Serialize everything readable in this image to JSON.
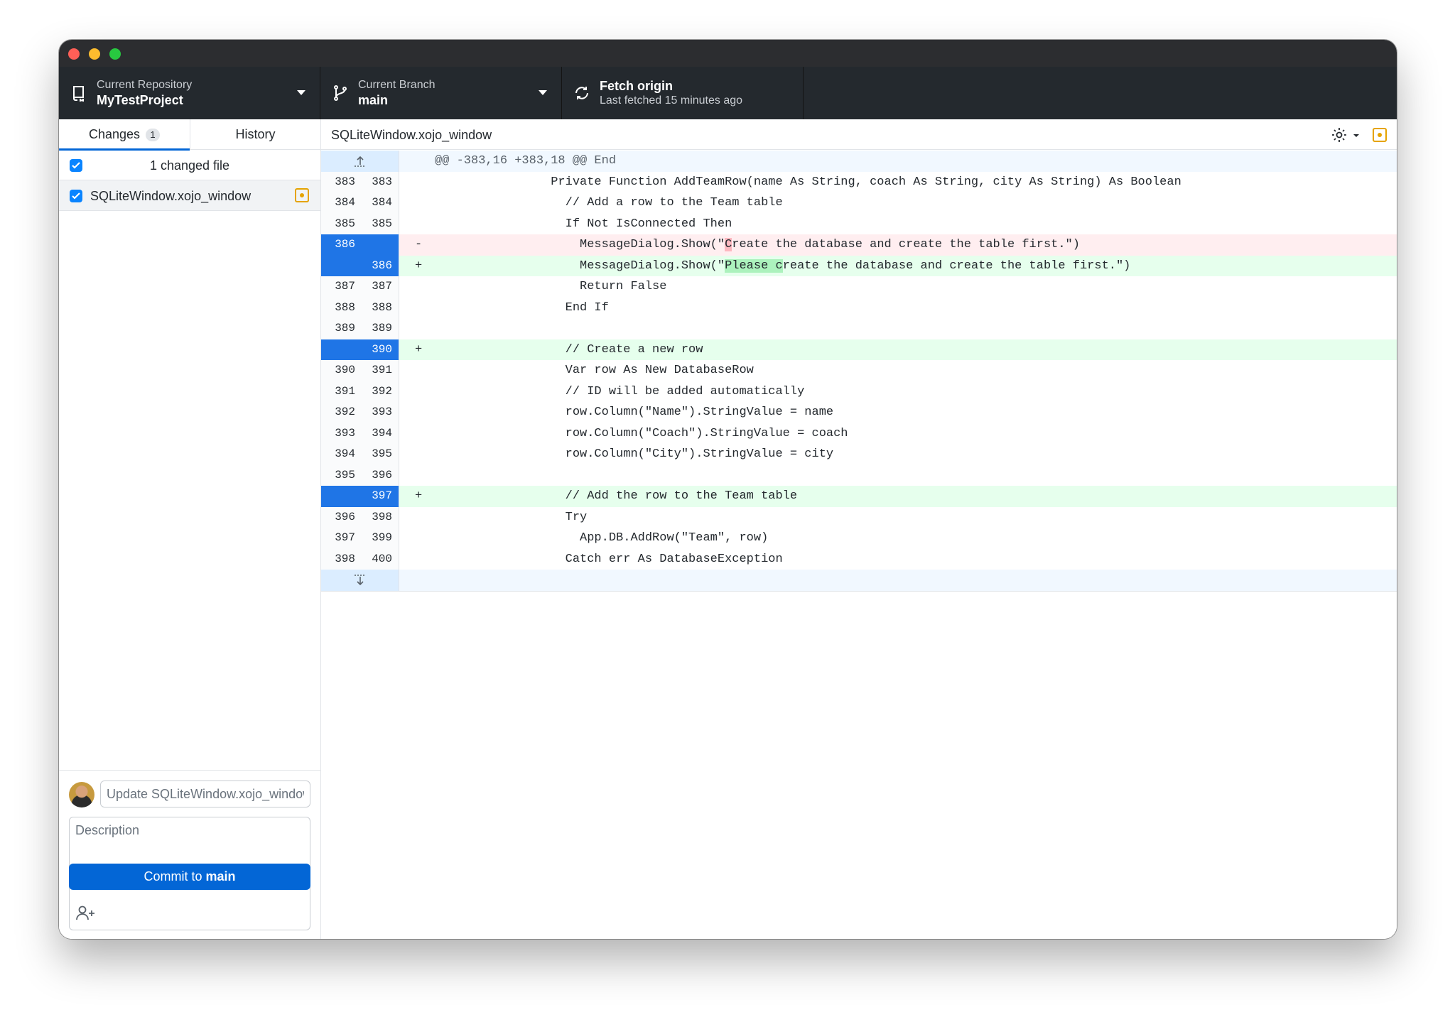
{
  "toolbar": {
    "repo_label": "Current Repository",
    "repo_value": "MyTestProject",
    "branch_label": "Current Branch",
    "branch_value": "main",
    "fetch_label": "Fetch origin",
    "fetch_status": "Last fetched 15 minutes ago"
  },
  "tabs": {
    "changes": "Changes",
    "changes_count": "1",
    "history": "History"
  },
  "changes_list": {
    "header": "1 changed file",
    "files": [
      {
        "name": "SQLiteWindow.xojo_window",
        "status": "modified",
        "checked": true
      }
    ]
  },
  "commit": {
    "summary_placeholder": "Update SQLiteWindow.xojo_window",
    "description_placeholder": "Description",
    "button_prefix": "Commit to ",
    "button_branch": "main"
  },
  "diff": {
    "title": "SQLiteWindow.xojo_window",
    "hunk_header": "@@ -383,16 +383,18 @@ End",
    "lines": [
      {
        "type": "context",
        "old": "383",
        "new": "383",
        "sign": "",
        "text": "                Private Function AddTeamRow(name As String, coach As String, city As String) As Boolean"
      },
      {
        "type": "context",
        "old": "384",
        "new": "384",
        "sign": "",
        "text": "                  // Add a row to the Team table"
      },
      {
        "type": "context",
        "old": "385",
        "new": "385",
        "sign": "",
        "text": "                  If Not IsConnected Then"
      },
      {
        "type": "del",
        "old": "386",
        "new": "",
        "sign": "-",
        "pre": "                    MessageDialog.Show(\"",
        "hl": "C",
        "post": "reate the database and create the table first.\")"
      },
      {
        "type": "add",
        "old": "",
        "new": "386",
        "sign": "+",
        "pre": "                    MessageDialog.Show(\"",
        "hl": "Please c",
        "post": "reate the database and create the table first.\")"
      },
      {
        "type": "context",
        "old": "387",
        "new": "387",
        "sign": "",
        "text": "                    Return False"
      },
      {
        "type": "context",
        "old": "388",
        "new": "388",
        "sign": "",
        "text": "                  End If"
      },
      {
        "type": "context",
        "old": "389",
        "new": "389",
        "sign": "",
        "text": ""
      },
      {
        "type": "add",
        "old": "",
        "new": "390",
        "sign": "+",
        "text": "                  // Create a new row"
      },
      {
        "type": "context",
        "old": "390",
        "new": "391",
        "sign": "",
        "text": "                  Var row As New DatabaseRow"
      },
      {
        "type": "context",
        "old": "391",
        "new": "392",
        "sign": "",
        "text": "                  // ID will be added automatically"
      },
      {
        "type": "context",
        "old": "392",
        "new": "393",
        "sign": "",
        "text": "                  row.Column(\"Name\").StringValue = name"
      },
      {
        "type": "context",
        "old": "393",
        "new": "394",
        "sign": "",
        "text": "                  row.Column(\"Coach\").StringValue = coach"
      },
      {
        "type": "context",
        "old": "394",
        "new": "395",
        "sign": "",
        "text": "                  row.Column(\"City\").StringValue = city"
      },
      {
        "type": "context",
        "old": "395",
        "new": "396",
        "sign": "",
        "text": ""
      },
      {
        "type": "add",
        "old": "",
        "new": "397",
        "sign": "+",
        "text": "                  // Add the row to the Team table"
      },
      {
        "type": "context",
        "old": "396",
        "new": "398",
        "sign": "",
        "text": "                  Try"
      },
      {
        "type": "context",
        "old": "397",
        "new": "399",
        "sign": "",
        "text": "                    App.DB.AddRow(\"Team\", row)"
      },
      {
        "type": "context",
        "old": "398",
        "new": "400",
        "sign": "",
        "text": "                  Catch err As DatabaseException"
      }
    ]
  },
  "colors": {
    "accent": "#0366d6",
    "gutter_changed": "#1f75e6",
    "add_bg": "#e6ffed",
    "del_bg": "#ffeef0",
    "modified": "#e5a300"
  },
  "icons": {
    "repo": "repo-icon",
    "branch": "git-branch-icon",
    "fetch": "sync-icon",
    "settings": "gear-icon",
    "modified": "file-modified-icon",
    "coauthor": "add-coauthor-icon",
    "expand_up": "expand-up-icon",
    "expand_down": "expand-down-icon"
  }
}
